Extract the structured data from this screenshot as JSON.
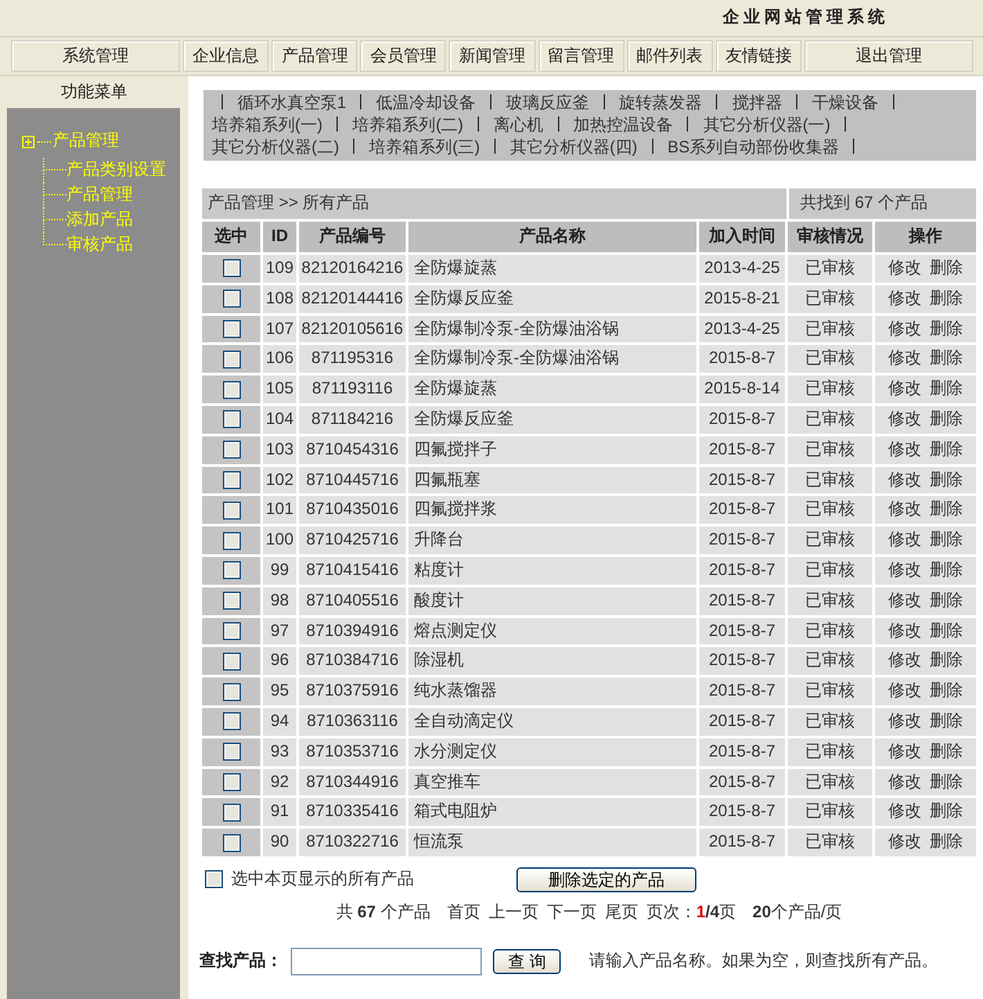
{
  "header": {
    "title": "企业网站管理系统"
  },
  "nav": [
    "系统管理",
    "企业信息",
    "产品管理",
    "会员管理",
    "新闻管理",
    "留言管理",
    "邮件列表",
    "友情链接",
    "退出管理"
  ],
  "sidebar": {
    "title": "功能菜单",
    "tree": [
      {
        "label": "产品管理",
        "children": [
          {
            "label": "产品类别设置"
          },
          {
            "label": "产品管理"
          },
          {
            "label": "添加产品"
          },
          {
            "label": "审核产品"
          }
        ]
      }
    ]
  },
  "categories": [
    "循环水真空泵1",
    "低温冷却设备",
    "玻璃反应釜",
    "旋转蒸发器",
    "搅拌器",
    "干燥设备",
    "培养箱系列(一)",
    "培养箱系列(二)",
    "离心机",
    "加热控温设备",
    "其它分析仪器(一)",
    "其它分析仪器(二)",
    "培养箱系列(三)",
    "其它分析仪器(四)",
    "BS系列自动部份收集器"
  ],
  "breadcrumb": {
    "path": "产品管理 >> 所有产品",
    "count": "共找到 67 个产品"
  },
  "table": {
    "columns": [
      "选中",
      "ID",
      "产品编号",
      "产品名称",
      "加入时间",
      "审核情况",
      "操作"
    ],
    "rows": [
      {
        "checked": false,
        "id": "109",
        "code": "82120164216",
        "name": "全防爆旋蒸",
        "date": "2013-4-25",
        "status": "已审核",
        "actions": [
          "修改",
          "删除"
        ]
      },
      {
        "checked": false,
        "id": "108",
        "code": "82120144416",
        "name": "全防爆反应釜",
        "date": "2015-8-21",
        "status": "已审核",
        "actions": [
          "修改",
          "删除"
        ]
      },
      {
        "checked": false,
        "id": "107",
        "code": "82120105616",
        "name": "全防爆制冷泵-全防爆油浴锅",
        "date": "2013-4-25",
        "status": "已审核",
        "actions": [
          "修改",
          "删除"
        ]
      },
      {
        "checked": false,
        "id": "106",
        "code": "871195316",
        "name": "全防爆制冷泵-全防爆油浴锅",
        "date": "2015-8-7",
        "status": "已审核",
        "actions": [
          "修改",
          "删除"
        ]
      },
      {
        "checked": false,
        "id": "105",
        "code": "871193116",
        "name": "全防爆旋蒸",
        "date": "2015-8-14",
        "status": "已审核",
        "actions": [
          "修改",
          "删除"
        ]
      },
      {
        "checked": false,
        "id": "104",
        "code": "871184216",
        "name": "全防爆反应釜",
        "date": "2015-8-7",
        "status": "已审核",
        "actions": [
          "修改",
          "删除"
        ]
      },
      {
        "checked": false,
        "id": "103",
        "code": "8710454316",
        "name": "四氟搅拌子",
        "date": "2015-8-7",
        "status": "已审核",
        "actions": [
          "修改",
          "删除"
        ]
      },
      {
        "checked": false,
        "id": "102",
        "code": "8710445716",
        "name": "四氟瓶塞",
        "date": "2015-8-7",
        "status": "已审核",
        "actions": [
          "修改",
          "删除"
        ]
      },
      {
        "checked": false,
        "id": "101",
        "code": "8710435016",
        "name": "四氟搅拌浆",
        "date": "2015-8-7",
        "status": "已审核",
        "actions": [
          "修改",
          "删除"
        ]
      },
      {
        "checked": false,
        "id": "100",
        "code": "8710425716",
        "name": "升降台",
        "date": "2015-8-7",
        "status": "已审核",
        "actions": [
          "修改",
          "删除"
        ]
      },
      {
        "checked": false,
        "id": "99",
        "code": "8710415416",
        "name": "粘度计",
        "date": "2015-8-7",
        "status": "已审核",
        "actions": [
          "修改",
          "删除"
        ]
      },
      {
        "checked": false,
        "id": "98",
        "code": "8710405516",
        "name": "酸度计",
        "date": "2015-8-7",
        "status": "已审核",
        "actions": [
          "修改",
          "删除"
        ]
      },
      {
        "checked": false,
        "id": "97",
        "code": "8710394916",
        "name": "熔点测定仪",
        "date": "2015-8-7",
        "status": "已审核",
        "actions": [
          "修改",
          "删除"
        ]
      },
      {
        "checked": false,
        "id": "96",
        "code": "8710384716",
        "name": "除湿机",
        "date": "2015-8-7",
        "status": "已审核",
        "actions": [
          "修改",
          "删除"
        ]
      },
      {
        "checked": false,
        "id": "95",
        "code": "8710375916",
        "name": "纯水蒸馏器",
        "date": "2015-8-7",
        "status": "已审核",
        "actions": [
          "修改",
          "删除"
        ]
      },
      {
        "checked": false,
        "id": "94",
        "code": "8710363116",
        "name": "全自动滴定仪",
        "date": "2015-8-7",
        "status": "已审核",
        "actions": [
          "修改",
          "删除"
        ]
      },
      {
        "checked": false,
        "id": "93",
        "code": "8710353716",
        "name": "水分测定仪",
        "date": "2015-8-7",
        "status": "已审核",
        "actions": [
          "修改",
          "删除"
        ]
      },
      {
        "checked": false,
        "id": "92",
        "code": "8710344916",
        "name": "真空推车",
        "date": "2015-8-7",
        "status": "已审核",
        "actions": [
          "修改",
          "删除"
        ]
      },
      {
        "checked": false,
        "id": "91",
        "code": "8710335416",
        "name": "箱式电阻炉",
        "date": "2015-8-7",
        "status": "已审核",
        "actions": [
          "修改",
          "删除"
        ]
      },
      {
        "checked": false,
        "id": "90",
        "code": "8710322716",
        "name": "恒流泵",
        "date": "2015-8-7",
        "status": "已审核",
        "actions": [
          "修改",
          "删除"
        ]
      }
    ]
  },
  "select_all": {
    "label": "选中本页显示的所有产品",
    "checked": false
  },
  "delete_button": "删除选定的产品",
  "pagination": {
    "total": "共 **67** 个产品",
    "links": [
      "首页",
      "上一页",
      "下一页",
      "尾页"
    ],
    "page_label": "页次：",
    "current_page": "1",
    "page_count": "**/4**页",
    "per_page": "**20**个产品/页"
  },
  "search": {
    "label": "查找产品：",
    "button": "查 询",
    "hint": "请输入产品名称。如果为空，则查找所有产品。"
  }
}
